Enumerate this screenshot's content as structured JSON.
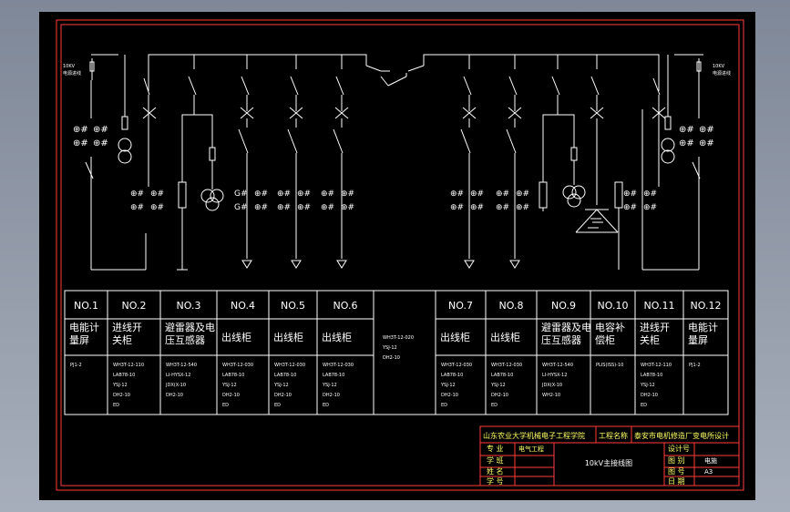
{
  "panels": [
    {
      "no": "NO.1",
      "name": [
        "电能计",
        "量屏"
      ],
      "specs": [
        "PJ1-2"
      ]
    },
    {
      "no": "NO.2",
      "name": [
        "进线开",
        "关柜"
      ],
      "specs": [
        "WH3T-12-110",
        "LAB78-10",
        "YSJ-12",
        "DH2-10",
        "ED"
      ]
    },
    {
      "no": "NO.3",
      "name": [
        "避雷器及电",
        "压互感器"
      ],
      "specs": [
        "WH3T-12-540",
        "LI-HYSX-12",
        "JDX(X-10",
        "DH2-10"
      ]
    },
    {
      "no": "NO.4",
      "name": [
        "出线柜"
      ],
      "specs": [
        "WH3T-12-030",
        "LAB78-10",
        "YSJ-12",
        "DH2-10",
        "ED"
      ]
    },
    {
      "no": "NO.5",
      "name": [
        "出线柜"
      ],
      "specs": [
        "WH3T-12-030",
        "LAB78-10",
        "YSJ-12",
        "DH2-10",
        "ED"
      ]
    },
    {
      "no": "NO.6",
      "name": [
        "出线柜"
      ],
      "specs": [
        "WH3T-12-030",
        "LAB78-10",
        "YSJ-12",
        "DH2-10",
        "ED"
      ]
    },
    {
      "no": "NO.7",
      "name": [
        "出线柜"
      ],
      "specs": [
        "WH3T-12-030",
        "LAB78-10",
        "YSJ-12",
        "DH2-10",
        "ED"
      ]
    },
    {
      "no": "NO.8",
      "name": [
        "出线柜"
      ],
      "specs": [
        "WH3T-12-030",
        "LAB78-10",
        "YSJ-12",
        "DH2-10",
        "ED"
      ]
    },
    {
      "no": "NO.9",
      "name": [
        "避雷器及电",
        "压互感器"
      ],
      "specs": [
        "WH3T-12-540",
        "LI-HYSX-12",
        "JDX(X-10",
        "WH2-10"
      ]
    },
    {
      "no": "NO.10",
      "name": [
        "电容补",
        "偿柜"
      ],
      "specs": [
        "PLIS(ISS)-10"
      ]
    },
    {
      "no": "NO.11",
      "name": [
        "进线开",
        "关柜"
      ],
      "specs": [
        "WH3T-12-110",
        "LAB78-10",
        "YSJ-12",
        "DH2-10",
        "ED"
      ]
    },
    {
      "no": "NO.12",
      "name": [
        "电能计",
        "量屏"
      ],
      "specs": [
        "PJ1-2"
      ]
    }
  ],
  "bus_tie_specs": [
    "WH3T-12-020",
    "YSJ-12",
    "DH2-10"
  ],
  "feed_labels": {
    "left": [
      "10KV",
      "电源进线"
    ],
    "right": [
      "10KV",
      "电源进线"
    ]
  },
  "title_block": {
    "school": "山东农业大学机械电子工程学院",
    "project_label": "工程名称",
    "project_name": "泰安市电机修造厂变电所设计",
    "drawing_title": "10kV主接线图",
    "rows": [
      {
        "label": "专 业",
        "value": "电气工程"
      },
      {
        "label": "学 班",
        "value": ""
      },
      {
        "label": "姓 名",
        "value": ""
      },
      {
        "label": "学 号",
        "value": ""
      }
    ],
    "right_rows": [
      {
        "label": "设计号",
        "value": ""
      },
      {
        "label": "图 别",
        "value": "电施"
      },
      {
        "label": "图 号",
        "value": "A3"
      },
      {
        "label": "日 期",
        "value": ""
      }
    ]
  }
}
